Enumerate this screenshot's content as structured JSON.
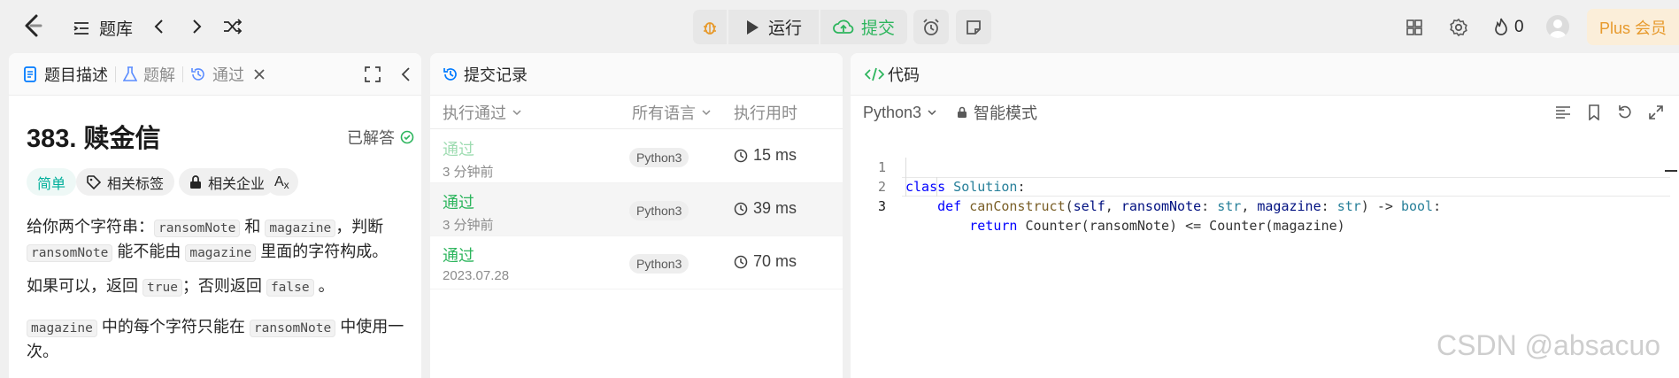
{
  "topbar": {
    "problem_list_label": "题库",
    "run_label": "运行",
    "submit_label": "提交",
    "streak_count": "0",
    "plus_label": "Plus 会员"
  },
  "left_panel": {
    "tabs": [
      {
        "label": "题目描述",
        "icon": "description-icon"
      },
      {
        "label": "题解",
        "icon": "flask-icon"
      },
      {
        "label": "通过",
        "icon": "history-icon"
      }
    ],
    "problem_title": "383. 赎金信",
    "solved_label": "已解答",
    "tags": {
      "difficulty": "简单",
      "related_tags": "相关标签",
      "related_companies": "相关企业",
      "font_toggle": "A",
      "font_toggle_sub": "x"
    },
    "desc": {
      "p1_a": "给你两个字符串：",
      "p1_code1": "ransomNote",
      "p1_b": "和",
      "p1_code2": "magazine",
      "p1_c": "，判断",
      "p1_code3": "ransomNote",
      "p1_d": "能不能由",
      "p1_code4": "magazine",
      "p1_e": "里面的字符构成。",
      "p2_a": "如果可以，返回",
      "p2_code1": "true",
      "p2_b": "；否则返回",
      "p2_code2": "false",
      "p2_c": "。",
      "p3_code1": "magazine",
      "p3_a": "中的每个字符只能在",
      "p3_code2": "ransomNote",
      "p3_b": "中使用一",
      "p3_c": "次。"
    }
  },
  "submissions_panel": {
    "title": "提交记录",
    "columns": {
      "status": "执行通过",
      "language": "所有语言",
      "runtime": "执行用时"
    },
    "rows": [
      {
        "status": "通过",
        "time": "3 分钟前",
        "language": "Python3",
        "runtime": "15 ms"
      },
      {
        "status": "通过",
        "time": "3 分钟前",
        "language": "Python3",
        "runtime": "39 ms"
      },
      {
        "status": "通过",
        "time": "2023.07.28",
        "language": "Python3",
        "runtime": "70 ms"
      }
    ]
  },
  "code_panel": {
    "title": "代码",
    "language": "Python3",
    "mode": "智能模式",
    "lines": [
      {
        "num": "1",
        "kw": "class",
        "rest": " Solution:"
      },
      {
        "num": "2",
        "indent": "    ",
        "kw": "def",
        "fn": "canConstruct",
        "p1": "self",
        "p2": "ransomNote",
        "t1": "str",
        "p3": "magazine",
        "t2": "str",
        "ret": "bool"
      },
      {
        "num": "3",
        "indent": "        ",
        "kw": "return",
        "rest": " Counter(ransomNote) <= Counter(magazine)"
      }
    ]
  },
  "watermark": "CSDN @absacuo",
  "colors": {
    "accent_green": "#2db55d",
    "easy": "#00af9b",
    "plus": "#e79a2d",
    "link_blue": "#007aff"
  }
}
